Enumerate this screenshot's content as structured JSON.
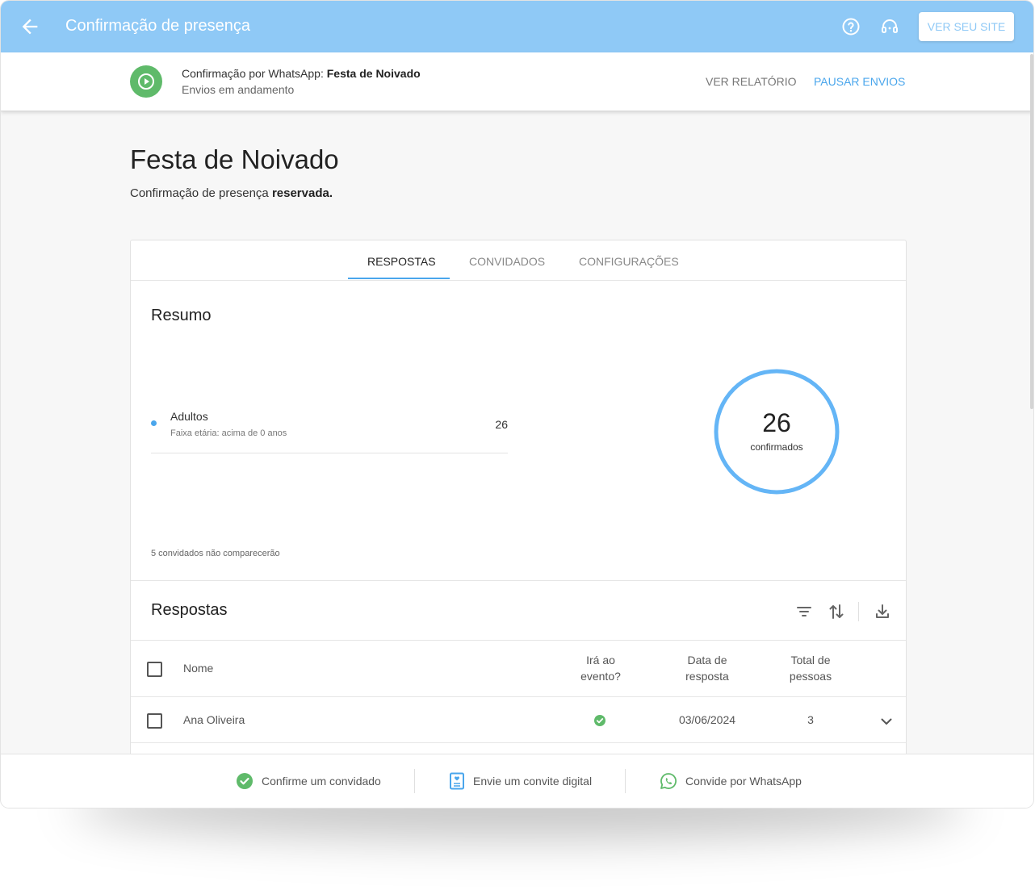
{
  "topbar": {
    "title": "Confirmação de presença",
    "site_button": "VER SEU SITE"
  },
  "status": {
    "label_prefix": "Confirmação por WhatsApp:",
    "event_name": "Festa de Noivado",
    "state": "Envios em andamento",
    "report_button": "VER RELATÓRIO",
    "pause_button": "PAUSAR ENVIOS"
  },
  "event": {
    "title": "Festa de Noivado",
    "subtitle_prefix": "Confirmação de presença",
    "subtitle_bold": "reservada."
  },
  "tabs": [
    "RESPOSTAS",
    "CONVIDADOS",
    "CONFIGURAÇÕES"
  ],
  "active_tab": "RESPOSTAS",
  "summary": {
    "title": "Resumo",
    "group_label": "Adultos",
    "group_sub": "Faixa etária: acima de 0 anos",
    "group_value": "26",
    "total_number": "26",
    "total_label": "confirmados",
    "not_attending": "5 convidados não comparecerão",
    "accent_color": "#64b5f6"
  },
  "responses": {
    "title": "Respostas",
    "columns": {
      "name": "Nome",
      "attending_1": "Irá ao",
      "attending_2": "evento?",
      "date_1": "Data de",
      "date_2": "resposta",
      "total_1": "Total de",
      "total_2": "pessoas"
    },
    "rows": [
      {
        "name": "Ana Oliveira",
        "attending": "check-icon",
        "date": "03/06/2024",
        "total": "3"
      }
    ]
  },
  "bottom_bar": {
    "confirm": "Confirme um convidado",
    "invite": "Envie um convite digital",
    "whatsapp": "Convide por WhatsApp"
  },
  "colors": {
    "topbar": "#8fc9f6",
    "accent": "#4aa6ec",
    "success": "#5fba6a"
  }
}
